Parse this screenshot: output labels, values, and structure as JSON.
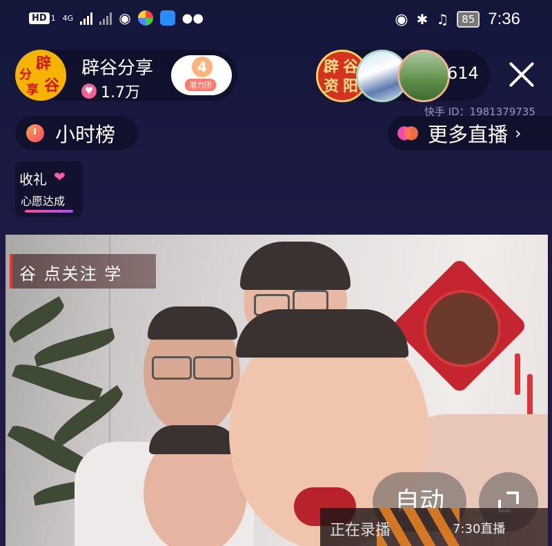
{
  "status_bar": {
    "hd_label": "HD",
    "sim_label": "1",
    "network": "4G",
    "battery": "85",
    "time": "7:36"
  },
  "host": {
    "avatar_chars": [
      "辟",
      "谷",
      "分",
      "享"
    ],
    "name": "辟谷分享",
    "likes": "1.7万",
    "badge_level": "4",
    "badge_label": "潜力团"
  },
  "viewers": {
    "avatar1_chars": [
      "辟",
      "谷",
      "资",
      "阳"
    ],
    "count": "614"
  },
  "kuaishou_id": "快手 ID：1981379735",
  "hour_rank_label": "小时榜",
  "more_live_label": "更多直播",
  "gift_wish": {
    "title": "收礼",
    "subtitle": "心愿达成"
  },
  "video": {
    "banner_text": "谷 点关注 学",
    "auto_label": "自动",
    "recording_label": "正在录播",
    "live_time": "7:30直播"
  },
  "colors": {
    "background": "#1c1b45",
    "accent_pink": "#f24bb0",
    "accent_orange": "#ff7a45"
  }
}
